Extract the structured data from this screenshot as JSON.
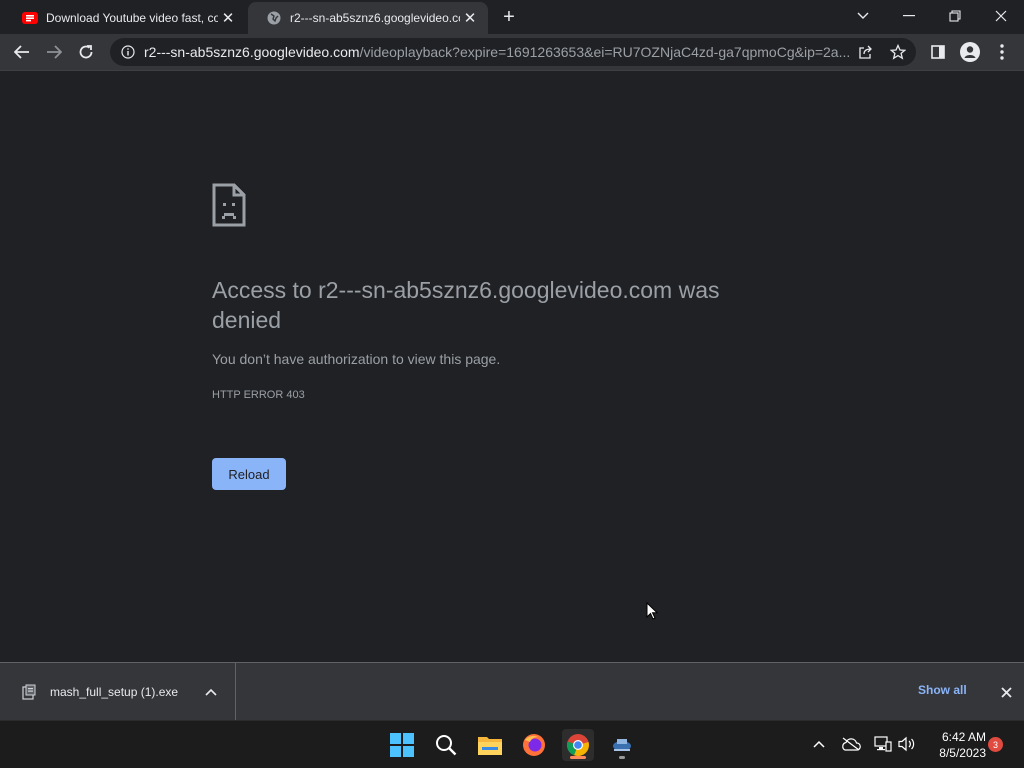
{
  "tabs": [
    {
      "title": "Download Youtube video fast, co",
      "icon": "youtube-icon",
      "active": false
    },
    {
      "title": "r2---sn-ab5sznz6.googlevideo.co",
      "icon": "globe-icon",
      "active": true
    }
  ],
  "address_bar": {
    "host": "r2---sn-ab5sznz6.googlevideo.com",
    "path": "/videoplayback?expire=1691263653&ei=RU7OZNjaC4zd-ga7qpmoCg&ip=2a..."
  },
  "error_page": {
    "title": "Access to r2---sn-ab5sznz6.googlevideo.com was denied",
    "description": "You don’t have authorization to view this page.",
    "code": "HTTP ERROR 403",
    "reload_label": "Reload"
  },
  "download_bar": {
    "filename": "mash_full_setup (1).exe",
    "show_all_label": "Show all"
  },
  "taskbar": {
    "apps": [
      "windows-start-icon",
      "search-icon",
      "file-explorer-icon",
      "firefox-icon",
      "chrome-icon",
      "app-icon"
    ],
    "time": "6:42 AM",
    "date": "8/5/2023",
    "notification_count": "3"
  },
  "colors": {
    "background": "#202124",
    "toolbar": "#35363a",
    "accent": "#8ab4f8",
    "text_muted": "#9aa0a6"
  }
}
